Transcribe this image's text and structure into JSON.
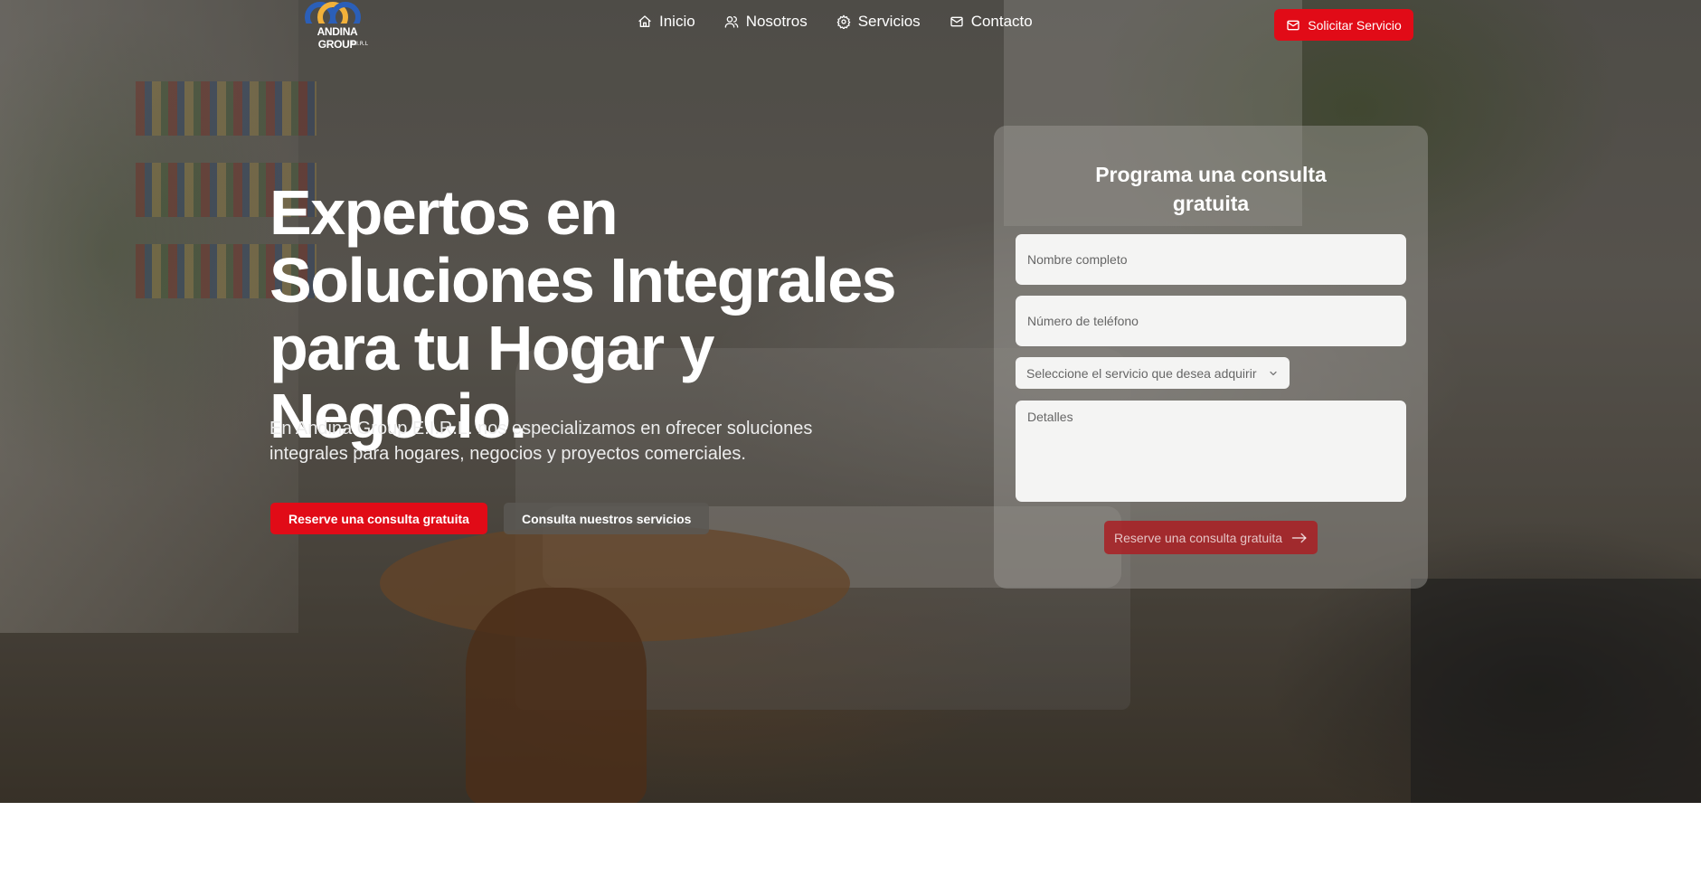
{
  "brand": {
    "logo_name": "ANDINA GROUP",
    "logo_sub": "E.I.R.L",
    "colors": {
      "accent": "#e10b17",
      "logo_blue": "#2b5fb8",
      "logo_yellow": "#f2b13a"
    }
  },
  "nav": {
    "items": [
      {
        "label": "Inicio",
        "icon": "home-icon"
      },
      {
        "label": "Nosotros",
        "icon": "users-icon"
      },
      {
        "label": "Servicios",
        "icon": "gear-icon"
      },
      {
        "label": "Contacto",
        "icon": "mail-icon"
      }
    ],
    "cta_label": "Solicitar Servicio",
    "cta_icon": "mail-icon"
  },
  "hero": {
    "headline": "Expertos en Soluciones Integrales para tu Hogar y Negocio.",
    "lead": "En Andina Group E.I.R.L. nos especializamos en ofrecer soluciones integrales para hogares, negocios y proyectos comerciales.",
    "primary_button": "Reserve una consulta gratuita",
    "secondary_button": "Consulta nuestros servicios"
  },
  "form": {
    "title": "Programa una consulta gratuita",
    "name_placeholder": "Nombre completo",
    "phone_placeholder": "Número de teléfono",
    "service_select": "Seleccione el servicio que desea adquirir",
    "details_placeholder": "Detalles",
    "submit_label": "Reserve una consulta gratuita"
  }
}
